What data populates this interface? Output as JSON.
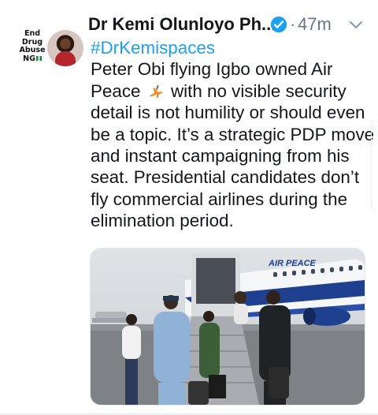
{
  "avatar": {
    "caption_lines": [
      "End",
      "Drug",
      "Abuse",
      "NG"
    ],
    "icon": "profile-photo"
  },
  "tweet": {
    "display_name": "Dr Kemi Olunloyo Ph...",
    "verified": true,
    "separator": "·",
    "time": "47m",
    "hashtag": "#DrKemispaces",
    "lines": [
      "Peter Obi flying Igbo owned Air",
      "with no visible security",
      "detail is not humility or should even",
      "be a topic. It’s a strategic PDP move",
      "and instant campaigning from his",
      "seat. Presidential candidates don’t",
      "fly commercial airlines during the",
      "elimination period."
    ],
    "line2_prefix": "Peace",
    "emoji": "airplane-emoji"
  },
  "media": {
    "aircraft_livery": "AIR PEACE",
    "icon": "photo-attachment"
  },
  "colors": {
    "accent": "#1da1f2",
    "text": "#14171a",
    "muted": "#657786"
  }
}
